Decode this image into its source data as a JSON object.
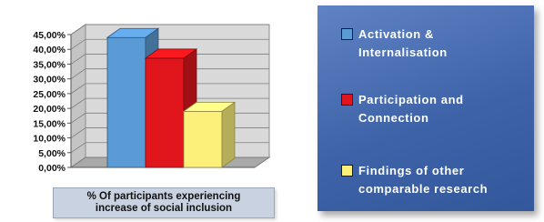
{
  "chart_data": {
    "type": "bar",
    "categories": [
      "% Of participants experiencing\nincrease of social inclusion"
    ],
    "series": [
      {
        "name": "Activation &\nInternalisation",
        "values": [
          44
        ],
        "color": "#5b9bd5"
      },
      {
        "name": "Participation and\nConnection",
        "values": [
          37
        ],
        "color": "#e0161c"
      },
      {
        "name": "Findings of other\ncomparable research",
        "values": [
          19
        ],
        "color": "#fdf07a"
      }
    ],
    "ylim": [
      0,
      45
    ],
    "yticks": [
      "0,00%",
      "5,00%",
      "10,00%",
      "15,00%",
      "20,00%",
      "25,00%",
      "30,00%",
      "35,00%",
      "40,00%",
      "45,00%"
    ],
    "ytick_values": [
      0,
      5,
      10,
      15,
      20,
      25,
      30,
      35,
      40,
      45
    ],
    "grid": true,
    "style": "3d-bar",
    "legend_position": "right"
  }
}
